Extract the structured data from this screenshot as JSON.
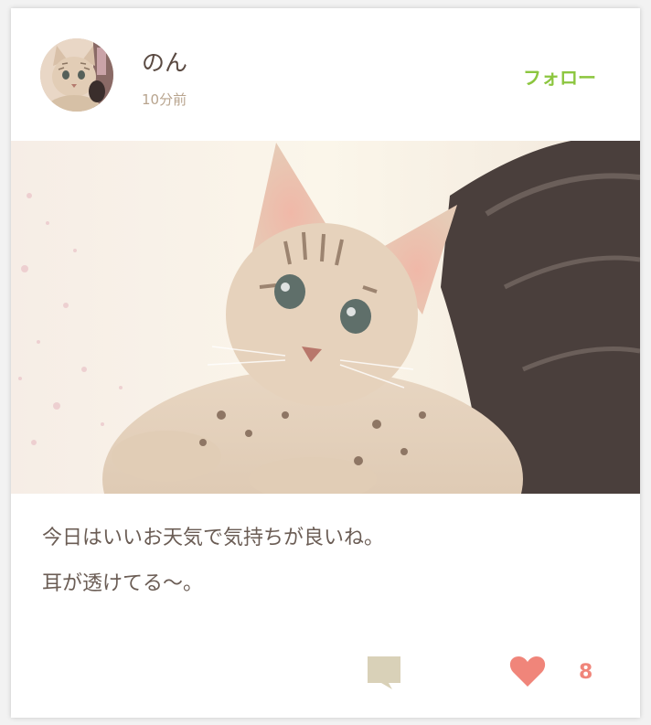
{
  "post": {
    "user": {
      "name": "のん",
      "time_ago": "10分前",
      "follow_label": "フォロー"
    },
    "image": {
      "subject": "kitten-photo"
    },
    "caption": {
      "line1": "今日はいいお天気で気持ちが良いね。",
      "line2": "耳が透けてる〜。"
    },
    "actions": {
      "comment_icon": "comment-icon",
      "like_icon": "heart-icon",
      "like_count": "8"
    }
  },
  "colors": {
    "follow": "#8cc63f",
    "like": "#f0857a",
    "comment_icon": "#d9d1b8",
    "text": "#6b5d55",
    "subtext": "#b8a48e"
  }
}
